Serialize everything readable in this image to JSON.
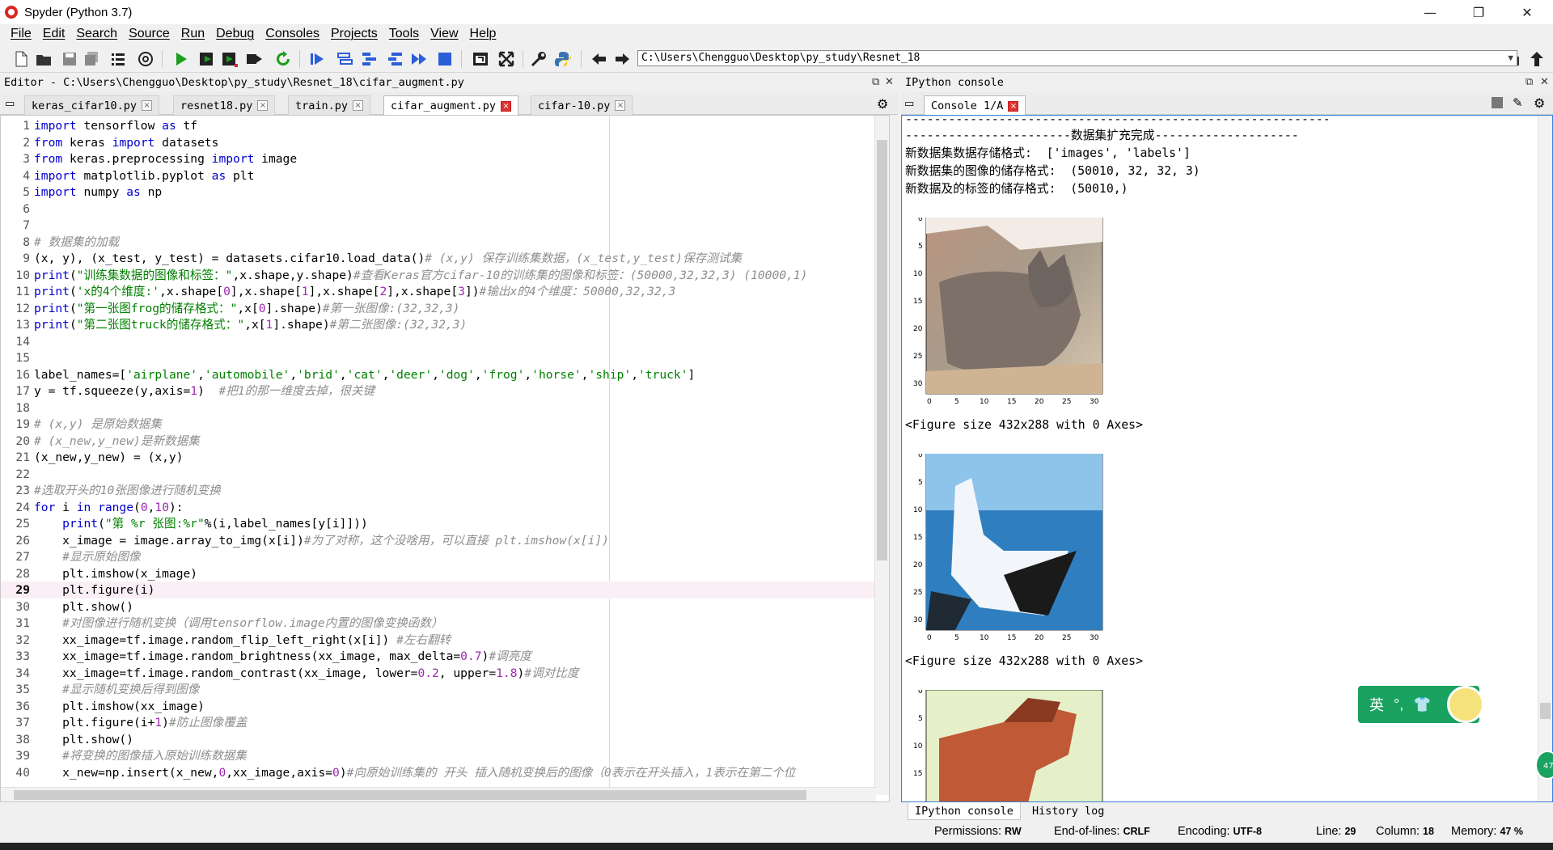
{
  "window": {
    "title": "Spyder (Python 3.7)",
    "minimize": "—",
    "maximize": "❐",
    "close": "✕"
  },
  "menu": [
    "File",
    "Edit",
    "Search",
    "Source",
    "Run",
    "Debug",
    "Consoles",
    "Projects",
    "Tools",
    "View",
    "Help"
  ],
  "toolbar": {
    "path": "C:\\Users\\Chengguo\\Desktop\\py_study\\Resnet_18",
    "icons": [
      "new-file-icon",
      "open-folder-icon",
      "save-icon",
      "save-all-icon",
      "browse-tabs-icon",
      "at-sign-icon",
      "run-icon",
      "run-cell-icon",
      "run-cell-advance-icon",
      "run-selection-icon",
      "rerun-icon",
      "debug-icon",
      "step-icon",
      "step-into-icon",
      "step-return-icon",
      "continue-icon",
      "stop-icon",
      "maximize-pane-icon",
      "fullscreen-icon",
      "preferences-icon",
      "python-path-icon",
      "back-icon",
      "forward-icon",
      "browse-dir-icon",
      "parent-dir-icon"
    ]
  },
  "editor": {
    "title": "Editor - C:\\Users\\Chengguo\\Desktop\\py_study\\Resnet_18\\cifar_augment.py",
    "tabs": [
      {
        "label": "keras_cifar10.py",
        "active": false
      },
      {
        "label": "resnet18.py",
        "active": false
      },
      {
        "label": "train.py",
        "active": false
      },
      {
        "label": "cifar_augment.py",
        "active": true
      },
      {
        "label": "cifar-10.py",
        "active": false
      }
    ],
    "current_line": 29,
    "lines": [
      "import tensorflow as tf",
      "from keras import datasets",
      "from keras.preprocessing import image",
      "import matplotlib.pyplot as plt",
      "import numpy as np",
      "",
      "",
      "# 数据集的加载",
      "(x, y), (x_test, y_test) = datasets.cifar10.load_data()# (x,y) 保存训练集数据，(x_test,y_test)保存测试集",
      "print(\"训练集数据的图像和标签：\",x.shape,y.shape)#查看Keras官方cifar-10的训练集的图像和标签：(50000,32,32,3) (10000,1)",
      "print('x的4个维度:',x.shape[0],x.shape[1],x.shape[2],x.shape[3])#输出x的4个维度：50000,32,32,3",
      "print(\"第一张图frog的储存格式：\",x[0].shape)#第一张图像:(32,32,3)",
      "print(\"第二张图truck的储存格式：\",x[1].shape)#第二张图像:(32,32,3)",
      "",
      "",
      "label_names=['airplane','automobile','brid','cat','deer','dog','frog','horse','ship','truck']",
      "y = tf.squeeze(y,axis=1)  #把1的那一维度去掉，很关键",
      "",
      "# (x,y) 是原始数据集",
      "# (x_new,y_new)是新数据集",
      "(x_new,y_new) = (x,y)",
      "",
      "#选取开头的10张图像进行随机变换",
      "for i in range(0,10):",
      "    print(\"第 %r 张图:%r\"%(i,label_names[y[i]]))",
      "    x_image = image.array_to_img(x[i])#为了对称，这个没啥用，可以直接 plt.imshow(x[i])",
      "    #显示原始图像",
      "    plt.imshow(x_image)",
      "    plt.figure(i)",
      "    plt.show()",
      "    #对图像进行随机变换（调用tensorflow.image内置的图像变换函数）",
      "    xx_image=tf.image.random_flip_left_right(x[i]) #左右翻转",
      "    xx_image=tf.image.random_brightness(xx_image, max_delta=0.7)#调亮度",
      "    xx_image=tf.image.random_contrast(xx_image, lower=0.2, upper=1.8)#调对比度",
      "    #显示随机变换后得到图像",
      "    plt.imshow(xx_image)",
      "    plt.figure(i+1)#防止图像覆盖",
      "    plt.show()",
      "    #将变换的图像插入原始训练数据集",
      "    x_new=np.insert(x_new,0,xx_image,axis=0)#向原始训练集的 开头 插入随机变换后的图像（0表示在开头插入，1表示在第二个位"
    ]
  },
  "console": {
    "title": "IPython console",
    "tab": "Console 1/A",
    "lines": [
      "-----------------------------------------------------------",
      "-----------------------数据集扩充完成--------------------",
      "新数据集数据存储格式:  ['images', 'labels']",
      "新数据集的图像的储存格式:  (50010, 32, 32, 3)",
      "新数据及的标签的储存格式:  (50010,)"
    ],
    "figure_caption": "<Figure size 432x288 with 0 Axes>",
    "plot_ticks": [
      "0",
      "5",
      "10",
      "15",
      "20",
      "25",
      "30"
    ],
    "plot_ticks_partial": [
      "0",
      "5",
      "10",
      "15"
    ],
    "bottom_tabs": [
      "IPython console",
      "History log"
    ]
  },
  "status": {
    "permissions_label": "Permissions:",
    "permissions": "RW",
    "eol_label": "End-of-lines:",
    "eol": "CRLF",
    "encoding_label": "Encoding:",
    "encoding": "UTF-8",
    "line_label": "Line:",
    "line": "29",
    "column_label": "Column:",
    "column": "18",
    "memory_label": "Memory:",
    "memory": "47 %"
  },
  "ime": {
    "lang": "英",
    "punct": "°,",
    "badge": "47"
  },
  "colors": {
    "keyword": "#0000cc",
    "string": "#008000",
    "comment": "#8e8e8e",
    "number": "#9c27b0",
    "run": "#1b9e1b",
    "stop": "#2b5ed8",
    "console_border": "#3b7fd8"
  }
}
